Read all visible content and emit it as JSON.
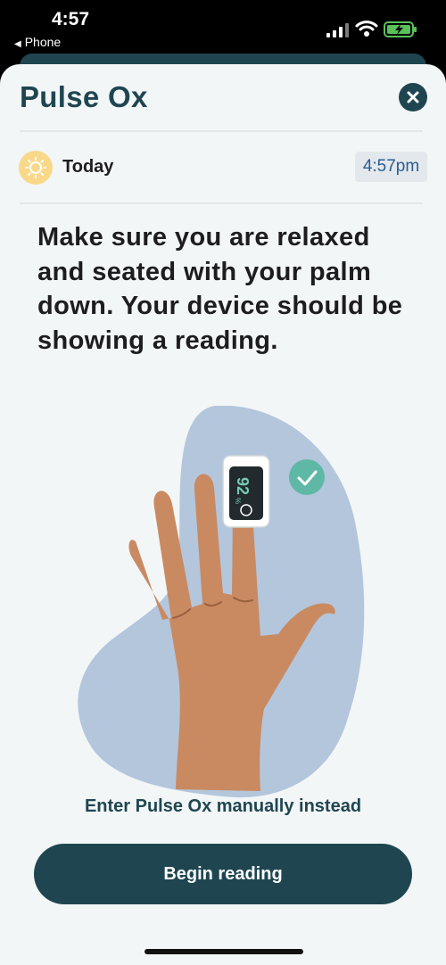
{
  "status_bar": {
    "time": "4:57",
    "back_app": "Phone",
    "back_icon": "triangle-left-icon"
  },
  "header": {
    "title": "Pulse Ox",
    "close_icon": "close-icon"
  },
  "date_row": {
    "icon": "sun-icon",
    "label": "Today",
    "time": "4:57pm"
  },
  "instructions": "Make sure you are relaxed and seated with your palm down. Your device should be showing a reading.",
  "illustration": {
    "device_reading": "92",
    "device_unit": "%",
    "check_icon": "check-icon"
  },
  "actions": {
    "manual_link": "Enter Pulse Ox manually instead",
    "primary_button": "Begin reading"
  },
  "colors": {
    "primary": "#1f4650",
    "background": "#f3f6f7",
    "accent": "#5fb8a5",
    "blob": "#b3c6dc",
    "skin": "#c98a62",
    "sun": "#f9d889"
  }
}
